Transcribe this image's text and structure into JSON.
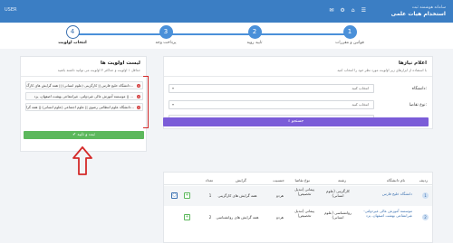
{
  "topbar": {
    "user_label": "USER",
    "brand_small": "سامانه هوشمند ثبت",
    "brand_title": "استخدام هیات علمی",
    "icons": [
      "envelope-icon",
      "gear-icon",
      "home-icon",
      "list-icon"
    ]
  },
  "wizard": {
    "steps": [
      {
        "num": "1",
        "label": "قوانین و مقررات"
      },
      {
        "num": "2",
        "label": "تایید رویه"
      },
      {
        "num": "3",
        "label": "پرداخت وجه"
      },
      {
        "num": "4",
        "label": "انتخاب اولویت"
      }
    ]
  },
  "priority_panel": {
    "title": "لیست اولویت ها",
    "subtitle": "حداقل ۱ اولویت و حداکثر ۳ اولویت می توانید داشته باشید",
    "items": [
      "دانشگاه خلیج فارس || کارگزینی (علوم انسانی) || همه گرایش های کارگ...",
      "موسسه آموزش عالی غیردولتی- غیرانتفاعی بهشت اصفهان، یزد || ...",
      "دانشگاه علوم انتظامی رضوی || علوم اجتماعی (علوم انسانی) || همه گرا..."
    ],
    "confirm_label": "✔ ثبت و تایید"
  },
  "search_panel": {
    "title": "اعلام نیازها",
    "subtitle": "با استفاده از ابزارهای زیر اولویت مورد نظر خود را انتخاب کنید",
    "university_label": "دانشگاه:",
    "university_value": "انتخاب کنید",
    "request_label": "نوع تقاضا:",
    "request_value": "انتخاب کنید",
    "field_label": "رشته:",
    "field_placeholder": "نام رشته مورد نظر را وارد کنید",
    "search_label": "جستجو"
  },
  "table": {
    "headers": [
      "ردیف",
      "نام دانشگاه",
      "رشته",
      "نوع تقاضا",
      "جنسیت",
      "گرایش",
      "تعداد"
    ],
    "rows": [
      {
        "index": "1",
        "university": "دانشگاه خلیج فارس",
        "major": "کارگزینی (علوم انسانی)",
        "request": "پیمانی (تبدیل تخصیص)",
        "gender": "هردو",
        "orientation": "همه گرایش های کارگزینی",
        "count": "1"
      },
      {
        "index": "2",
        "university": "موسسه آموزش عالی غیردولتی- غیرانتفاعی بهشت اصفهان، یزد",
        "major": "روانشناسی (علوم انسانی)",
        "request": "پیمانی (تبدیل تخصیص)",
        "gender": "هردو",
        "orientation": "همه گرایش های روانشناسی",
        "count": "2"
      }
    ]
  },
  "colors": {
    "topbar": "#3b7ec4",
    "accent": "#4a90d9",
    "confirm": "#5cb85c",
    "search": "#7b5cd8",
    "highlight": "#d42a2a"
  }
}
